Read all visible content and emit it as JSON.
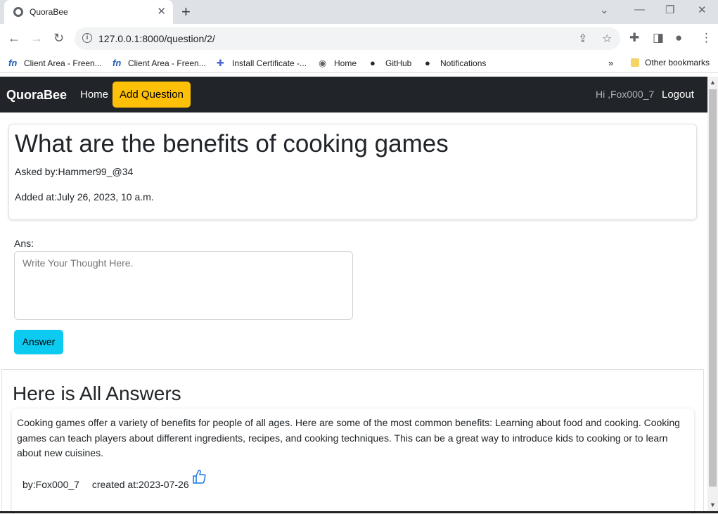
{
  "browser": {
    "tab_title": "QuoraBee",
    "url": "127.0.0.1:8000/question/2/",
    "bookmarks": [
      {
        "label": "Client Area - Freen...",
        "icon": "fn-icon"
      },
      {
        "label": "Client Area - Freen...",
        "icon": "fn-icon"
      },
      {
        "label": "Install Certificate -...",
        "icon": "puzzle-icon"
      },
      {
        "label": "Home",
        "icon": "globe-icon"
      },
      {
        "label": "GitHub",
        "icon": "github-icon"
      },
      {
        "label": "Notifications",
        "icon": "github-icon"
      }
    ],
    "other_bookmarks": "Other bookmarks"
  },
  "navbar": {
    "brand": "QuoraBee",
    "home": "Home",
    "add_question": "Add Question",
    "greeting": "Hi ,Fox000_7",
    "logout": "Logout"
  },
  "question": {
    "title": "What are the benefits of cooking games",
    "asked_by": "Asked by:Hammer99_@34",
    "added_at": "Added at:July 26, 2023, 10 a.m."
  },
  "answer_form": {
    "label": "Ans:",
    "placeholder": "Write Your Thought Here.",
    "button": "Answer"
  },
  "answers": {
    "title": "Here is All Answers",
    "items": [
      {
        "text": "Cooking games offer a variety of benefits for people of all ages. Here are some of the most common benefits: Learning about food and cooking. Cooking games can teach players about different ingredients, recipes, and cooking techniques. This can be a great way to introduce kids to cooking or to learn about new cuisines.",
        "by": "by:Fox000_7",
        "created": "created at:2023-07-26"
      }
    ]
  },
  "colors": {
    "navbar_bg": "#212529",
    "warning": "#ffc107",
    "info": "#0dcaf0",
    "like_icon": "#1a73e8"
  }
}
